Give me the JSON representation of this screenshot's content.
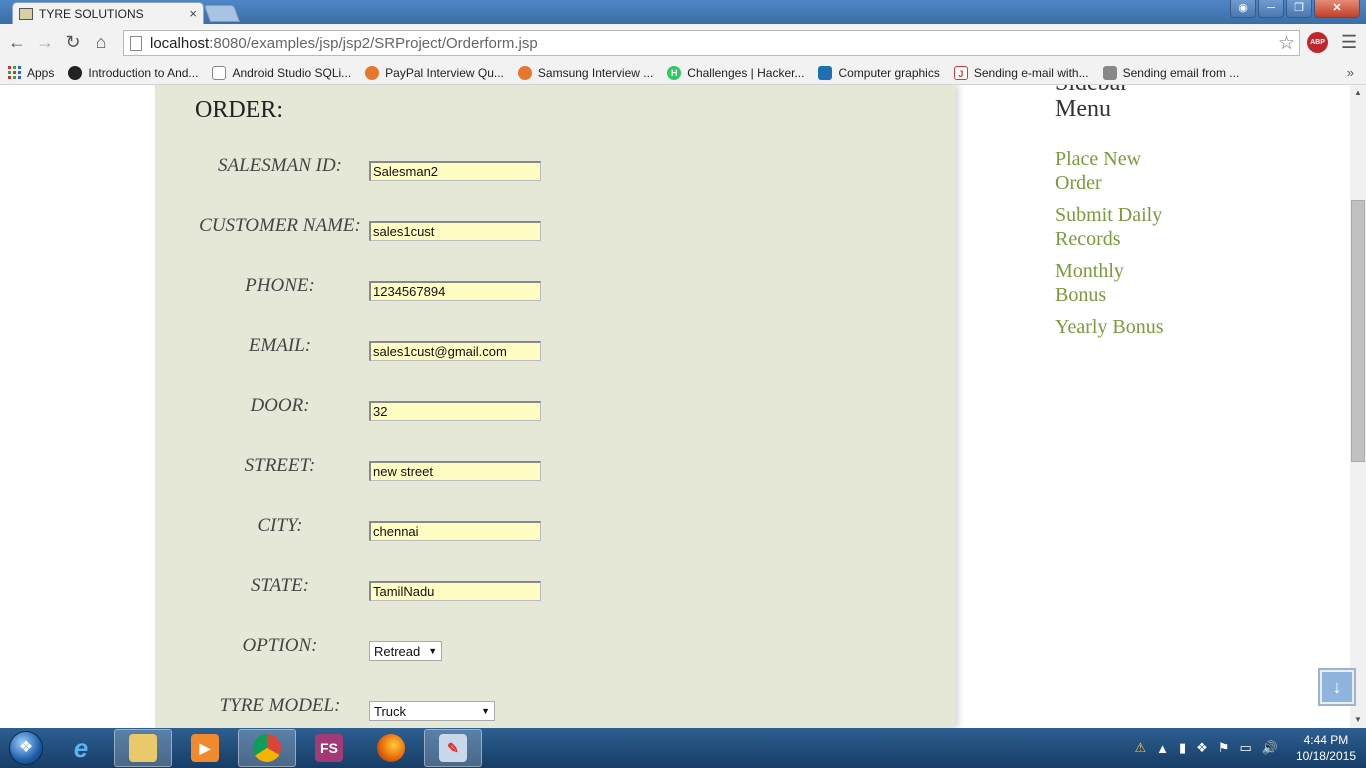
{
  "browser": {
    "tab_title": "TYRE SOLUTIONS",
    "tab_close": "×",
    "url_host": "localhost",
    "url_path": ":8080/examples/jsp/jsp2/SRProject/Orderform.jsp",
    "abp_label": "ABP",
    "bookmarks": [
      {
        "label": "Apps"
      },
      {
        "label": "Introduction to And..."
      },
      {
        "label": "Android Studio SQLi..."
      },
      {
        "label": "PayPal Interview Qu..."
      },
      {
        "label": "Samsung Interview ..."
      },
      {
        "label": "Challenges | Hacker..."
      },
      {
        "label": "Computer graphics"
      },
      {
        "label": "Sending e-mail with..."
      },
      {
        "label": "Sending email from ..."
      }
    ],
    "bookmarks_more": "»"
  },
  "order": {
    "heading": "ORDER:",
    "fields": [
      {
        "label": "SALESMAN ID:",
        "value": "Salesman2"
      },
      {
        "label": "CUSTOMER NAME:",
        "value": "sales1cust"
      },
      {
        "label": "PHONE:",
        "value": "1234567894"
      },
      {
        "label": "EMAIL:",
        "value": "sales1cust@gmail.com"
      },
      {
        "label": "DOOR:",
        "value": "32"
      },
      {
        "label": "STREET:",
        "value": "new street"
      },
      {
        "label": "CITY:",
        "value": "chennai"
      },
      {
        "label": "STATE:",
        "value": "TamilNadu"
      }
    ],
    "option": {
      "label": "OPTION:",
      "selected": "Retread"
    },
    "tyre_model": {
      "label": "TYRE MODEL:",
      "selected": "Truck"
    }
  },
  "sidebar": {
    "title": "Sidebar Menu",
    "links": [
      {
        "label": "Place New Order"
      },
      {
        "label": "Submit Daily Records"
      },
      {
        "label": "Monthly Bonus"
      },
      {
        "label": "Yearly Bonus"
      }
    ]
  },
  "taskbar": {
    "time": "4:44 PM",
    "date": "10/18/2015",
    "fs_label": "FS"
  },
  "colors": {
    "panel_bg": "#e6e8d7",
    "input_bg": "#fffdc4",
    "sidebar_link": "#7a9a3c"
  }
}
